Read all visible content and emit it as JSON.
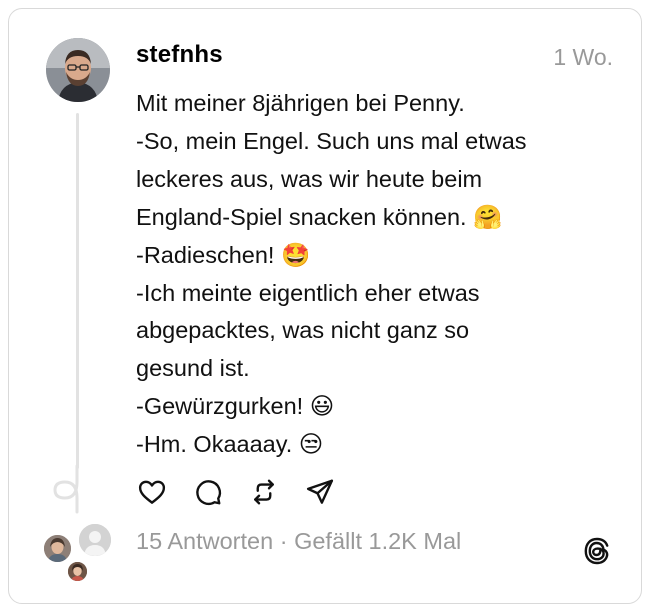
{
  "post": {
    "username": "stefnhs",
    "timestamp": "1 Wo.",
    "lines": [
      "Mit meiner 8jährigen bei Penny.",
      "-So, mein Engel. Such uns mal etwas",
      "leckeres aus, was wir heute beim",
      "England-Spiel snacken können. 🤗",
      "-Radieschen! 🤩",
      "-Ich meinte eigentlich eher etwas",
      "abgepacktes, was nicht ganz so",
      "gesund ist.",
      "-Gewürzgurken! 😃",
      "-Hm. Okaaaay. 😒"
    ]
  },
  "actions": {
    "icons": [
      "heart-icon",
      "comment-icon",
      "repost-icon",
      "share-icon"
    ]
  },
  "footer": {
    "stats": "15 Antworten · Gefällt 1.2K Mal",
    "logo": "threads-logo-icon"
  },
  "colors": {
    "muted": "#999999",
    "border": "#d9d9d9",
    "thread_line": "#e2e2e2"
  }
}
